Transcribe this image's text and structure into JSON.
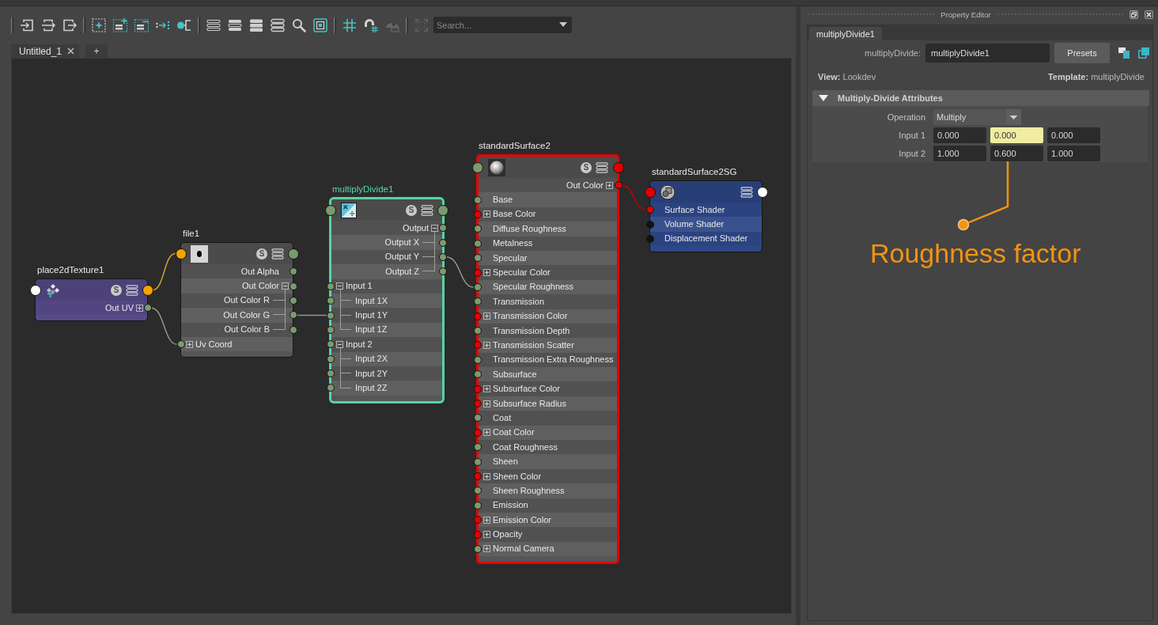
{
  "toolbar": {
    "groups": [
      {
        "tools": [
          {
            "disabled": false
          },
          {
            "disabled": false
          },
          {
            "disabled": false
          }
        ]
      },
      {
        "tools": [
          {
            "disabled": false
          },
          {
            "disabled": false
          },
          {
            "disabled": false
          },
          {
            "disabled": false
          },
          {
            "disabled": false
          }
        ]
      },
      {
        "tools": [
          {
            "disabled": false
          },
          {
            "disabled": false
          },
          {
            "disabled": false
          },
          {
            "disabled": false
          },
          {
            "disabled": false
          },
          {
            "disabled": false
          }
        ]
      },
      {
        "tools": [
          {
            "disabled": false
          },
          {
            "disabled": false
          },
          {
            "disabled": true
          }
        ]
      },
      {
        "tools": [
          {
            "disabled": true
          }
        ]
      }
    ],
    "search": {
      "placeholder": "Search..."
    }
  },
  "tabs": [
    {
      "label": "Untitled_1",
      "selected": true
    }
  ],
  "new_tab": "+",
  "graph": {
    "nodes": [
      {
        "kind": "placement",
        "title": "place2dTexture1",
        "selected": false,
        "highlighted": false,
        "color": "#574a8a",
        "badge": "S",
        "input_port": {
          "color": "#ffffff"
        },
        "output_port": {
          "color": "#f5a300"
        },
        "rows": [
          {
            "label": "Out UV",
            "kind": "output",
            "expanded": false,
            "color": "#7b9a6e"
          }
        ]
      },
      {
        "kind": "file",
        "title": "file1",
        "selected": false,
        "highlighted": false,
        "color": "#565656",
        "badge": "S",
        "input_port": {
          "color": "#f5a300"
        },
        "output_port": {
          "color": "#7b9a6e"
        },
        "rows": [
          {
            "label": "Out Alpha",
            "kind": "output",
            "color": "#7b9a6e"
          },
          {
            "label": "Out Color",
            "kind": "output",
            "expanded": true,
            "color": "#7b9a6e",
            "children": [
              {
                "label": "Out Color R",
                "kind": "output",
                "color": "#7b9a6e"
              },
              {
                "label": "Out Color G",
                "kind": "output",
                "color": "#7b9a6e"
              },
              {
                "label": "Out Color B",
                "kind": "output",
                "color": "#7b9a6e"
              }
            ]
          },
          {
            "label": "Uv Coord",
            "kind": "input",
            "expanded": false,
            "color": "#7b9a6e"
          }
        ]
      },
      {
        "kind": "multiply-divide",
        "title": "multiplyDivide1",
        "selected": true,
        "highlighted": false,
        "color": "#565656",
        "badge": "S",
        "input_port": {
          "color": "#7b9a6e"
        },
        "output_port": {
          "color": "#7b9a6e"
        },
        "rows": [
          {
            "label": "Output",
            "kind": "output",
            "expanded": true,
            "color": "#7b9a6e",
            "children": [
              {
                "label": "Output X",
                "kind": "output",
                "color": "#7b9a6e"
              },
              {
                "label": "Output Y",
                "kind": "output",
                "color": "#7b9a6e"
              },
              {
                "label": "Output Z",
                "kind": "output",
                "color": "#7b9a6e"
              }
            ]
          },
          {
            "label": "Input 1",
            "kind": "input",
            "expanded": true,
            "color": "#7b9a6e",
            "children": [
              {
                "label": "Input 1X",
                "kind": "input",
                "color": "#7b9a6e"
              },
              {
                "label": "Input 1Y",
                "kind": "input",
                "color": "#7b9a6e"
              },
              {
                "label": "Input 1Z",
                "kind": "input",
                "color": "#7b9a6e"
              }
            ]
          },
          {
            "label": "Input 2",
            "kind": "input",
            "expanded": true,
            "color": "#7b9a6e",
            "children": [
              {
                "label": "Input 2X",
                "kind": "input",
                "color": "#7b9a6e"
              },
              {
                "label": "Input 2Y",
                "kind": "input",
                "color": "#7b9a6e"
              },
              {
                "label": "Input 2Z",
                "kind": "input",
                "color": "#7b9a6e"
              }
            ]
          }
        ]
      },
      {
        "kind": "surface-shader",
        "title": "standardSurface2",
        "selected": false,
        "highlighted": true,
        "color": "#565656",
        "badge": "S",
        "input_port": {
          "color": "#7b9a6e"
        },
        "output_port": {
          "color": "#e50000"
        },
        "rows": [
          {
            "label": "Out Color",
            "kind": "output",
            "expanded": false,
            "color": "#e50000"
          },
          {
            "label": "Base",
            "kind": "input",
            "color": "#7b9a6e"
          },
          {
            "label": "Base Color",
            "kind": "input",
            "expanded": false,
            "color": "#e50000"
          },
          {
            "label": "Diffuse Roughness",
            "kind": "input",
            "color": "#7b9a6e"
          },
          {
            "label": "Metalness",
            "kind": "input",
            "color": "#7b9a6e"
          },
          {
            "label": "Specular",
            "kind": "input",
            "color": "#7b9a6e"
          },
          {
            "label": "Specular Color",
            "kind": "input",
            "expanded": false,
            "color": "#e50000"
          },
          {
            "label": "Specular Roughness",
            "kind": "input",
            "color": "#7b9a6e"
          },
          {
            "label": "Transmission",
            "kind": "input",
            "color": "#7b9a6e"
          },
          {
            "label": "Transmission Color",
            "kind": "input",
            "expanded": false,
            "color": "#e50000"
          },
          {
            "label": "Transmission Depth",
            "kind": "input",
            "color": "#7b9a6e"
          },
          {
            "label": "Transmission Scatter",
            "kind": "input",
            "expanded": false,
            "color": "#e50000"
          },
          {
            "label": "Transmission Extra Roughness",
            "kind": "input",
            "color": "#7b9a6e"
          },
          {
            "label": "Subsurface",
            "kind": "input",
            "color": "#7b9a6e"
          },
          {
            "label": "Subsurface Color",
            "kind": "input",
            "expanded": false,
            "color": "#e50000"
          },
          {
            "label": "Subsurface Radius",
            "kind": "input",
            "expanded": false,
            "color": "#e50000"
          },
          {
            "label": "Coat",
            "kind": "input",
            "color": "#7b9a6e"
          },
          {
            "label": "Coat Color",
            "kind": "input",
            "expanded": false,
            "color": "#e50000"
          },
          {
            "label": "Coat Roughness",
            "kind": "input",
            "color": "#7b9a6e"
          },
          {
            "label": "Sheen",
            "kind": "input",
            "color": "#7b9a6e"
          },
          {
            "label": "Sheen Color",
            "kind": "input",
            "expanded": false,
            "color": "#e50000"
          },
          {
            "label": "Sheen Roughness",
            "kind": "input",
            "color": "#7b9a6e"
          },
          {
            "label": "Emission",
            "kind": "input",
            "color": "#7b9a6e"
          },
          {
            "label": "Emission Color",
            "kind": "input",
            "expanded": false,
            "color": "#e50000"
          },
          {
            "label": "Opacity",
            "kind": "input",
            "expanded": false,
            "color": "#e50000"
          },
          {
            "label": "Normal Camera",
            "kind": "input",
            "expanded": false,
            "color": "#7b9a6e"
          }
        ]
      },
      {
        "kind": "shading-group",
        "title": "standardSurface2SG",
        "selected": false,
        "highlighted": false,
        "color": "#2e4787",
        "input_port": {
          "color": "#e50000"
        },
        "output_port": {
          "color": "#ffffff"
        },
        "rows": [
          {
            "label": "Surface Shader",
            "kind": "input",
            "color": "#e50000"
          },
          {
            "label": "Volume Shader",
            "kind": "input",
            "color": "#111111"
          },
          {
            "label": "Displacement Shader",
            "kind": "input",
            "color": "#111111"
          }
        ]
      }
    ],
    "wires": [
      {
        "color": "#d9a536"
      },
      {
        "color": "#9a9c88"
      },
      {
        "color": "#9a9c88"
      },
      {
        "color": "#9a9c88"
      },
      {
        "color": "#c40000"
      }
    ]
  },
  "property_editor": {
    "title": "Property Editor",
    "tabs": [
      {
        "label": "multiplyDivide1",
        "selected": true
      }
    ],
    "name_field": {
      "label": "multiplyDivide:",
      "value": "multiplyDivide1"
    },
    "presets_button": "Presets",
    "view": "**View:** Lookdev",
    "template": "**Template:** multiplyDivide",
    "sections": [
      {
        "title": "Multiply-Divide Attributes",
        "expanded": true,
        "attributes": [
          {
            "kind": "dropdown",
            "label": "Operation",
            "value": "Multiply"
          },
          {
            "kind": "vector",
            "label": "Input 1",
            "fields": [
              {
                "value": "0.000",
                "connected": false
              },
              {
                "value": "0.000",
                "connected": true
              },
              {
                "value": "0.000",
                "connected": false
              }
            ]
          },
          {
            "kind": "vector",
            "label": "Input 2",
            "fields": [
              {
                "value": "1.000",
                "connected": false
              },
              {
                "value": "0.600",
                "connected": false
              },
              {
                "value": "1.000",
                "connected": false
              }
            ]
          }
        ]
      }
    ]
  },
  "annotation": {
    "text": "Roughness factor"
  }
}
